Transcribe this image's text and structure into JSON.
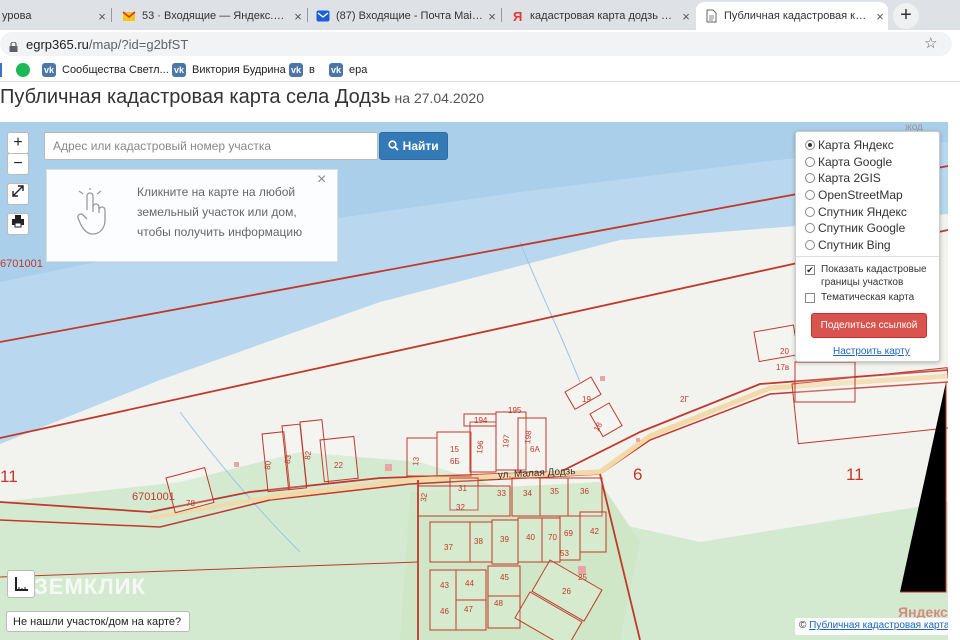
{
  "browser": {
    "tabs": [
      {
        "title": "урова",
        "icon": "person"
      },
      {
        "title": "53 · Входящие — Яндекс.Почта",
        "icon": "mail-yandex"
      },
      {
        "title": "(87) Входящие - Почта Mail.ru",
        "icon": "mail-ru"
      },
      {
        "title": "кадастровая карта додзь — Ян",
        "icon": "yandex"
      },
      {
        "title": "Публичная кадастровая карта",
        "icon": "document"
      }
    ],
    "new_tab": "+",
    "close": "×",
    "url_host": "egrp365.ru",
    "url_path": "/map/?id=g2bfST",
    "bookmarks": [
      {
        "label": "",
        "icon": "circle-green"
      },
      {
        "label": "Сообщества Светл...",
        "icon": "vk"
      },
      {
        "label": "Виктория Будрина",
        "icon": "vk"
      },
      {
        "label": "в",
        "icon": "vk"
      },
      {
        "label": "ера",
        "icon": "vk"
      }
    ]
  },
  "page": {
    "title": "Публичная кадастровая карта села Додзь",
    "date_prefix": "на 27.04.2020"
  },
  "map": {
    "zoom_in": "+",
    "zoom_out": "−",
    "search_placeholder": "Адрес или кадастровый номер участка",
    "find_label": "Найти",
    "hint_text": "Кликните на карте на любой земельный участок или дом, чтобы получить информацию",
    "hint_close": "×",
    "layers": [
      {
        "label": "Карта Яндекс",
        "selected": true
      },
      {
        "label": "Карта Google",
        "selected": false
      },
      {
        "label": "Карта 2GIS",
        "selected": false
      },
      {
        "label": "OpenStreetMap",
        "selected": false
      },
      {
        "label": "Спутник Яндекс",
        "selected": false
      },
      {
        "label": "Спутник Google",
        "selected": false
      },
      {
        "label": "Спутник Bing",
        "selected": false
      }
    ],
    "show_borders_label": "Показать кадастровые границы участков",
    "show_borders_checked": true,
    "thematic_label": "Тематическая карта",
    "thematic_checked": false,
    "share_label": "Поделиться ссылкой",
    "setup_label": "Настроить карту",
    "not_found_label": "Не нашли участок/дом на карте?",
    "watermark": "ЗЕМКЛИК",
    "yandex_label": "Яндекс",
    "copyright_prefix": "©",
    "copyright_link": "Публичная кадастровая карта",
    "top_right_fragment": "жод",
    "street_label": "ул. Малая Додзь",
    "quarter_labels": [
      "6701001",
      "6701001",
      "11",
      "6",
      "11"
    ],
    "parcel_numbers": [
      "80",
      "83",
      "82",
      "22",
      "13",
      "15",
      "6Б",
      "196",
      "194",
      "195",
      "197",
      "198",
      "19",
      "18",
      "20",
      "17в",
      "2Г",
      "6А",
      "31",
      "32",
      "33",
      "34",
      "35",
      "36",
      "32",
      "78",
      "37",
      "38",
      "39",
      "40",
      "70",
      "69",
      "42",
      "53",
      "25",
      "26",
      "43",
      "44",
      "45",
      "46",
      "47",
      "48",
      "26"
    ]
  },
  "colors": {
    "water": "#b9d8ef",
    "land": "#f2f2ee",
    "forest": "#cfe7c6",
    "parcel_border": "#c0392b",
    "button_blue": "#337ab7",
    "button_red": "#d9534f"
  }
}
